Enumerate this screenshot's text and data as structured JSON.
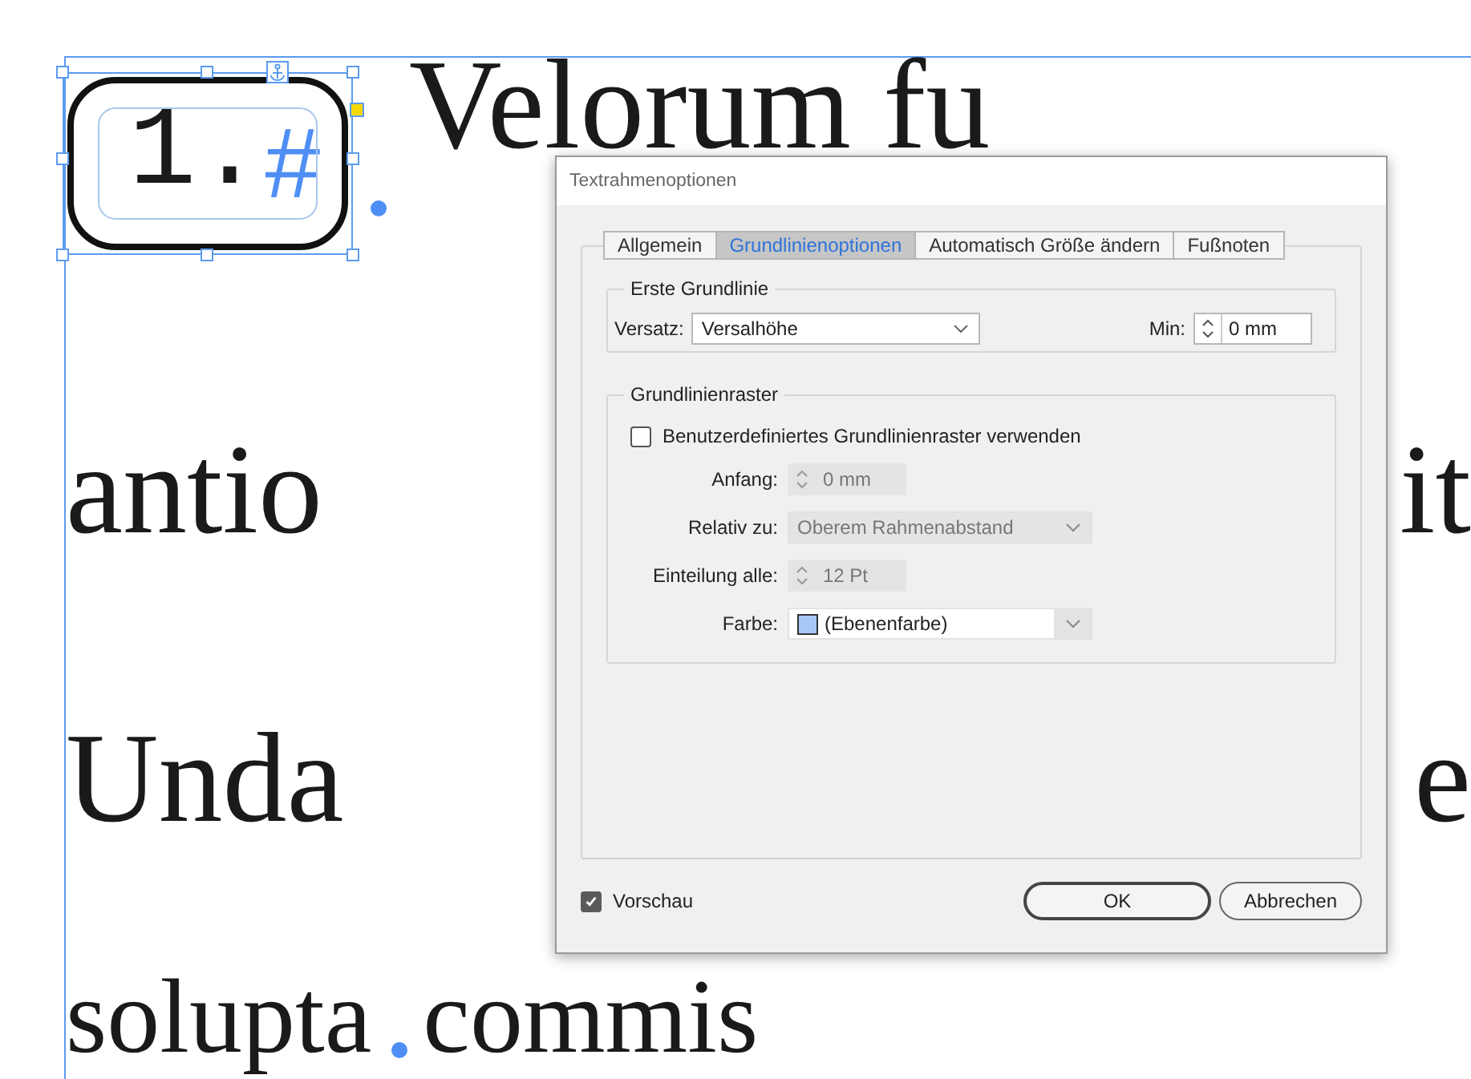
{
  "document": {
    "anchored_frame": {
      "number": "1.",
      "marker": "#"
    },
    "lines": [
      {
        "kind": "anchored",
        "segments": [
          "Velorum fu"
        ]
      },
      {
        "kind": "split",
        "segments": [
          "antio",
          "it"
        ]
      },
      {
        "kind": "split",
        "segments": [
          "Unda",
          "e"
        ]
      },
      {
        "kind": "dotted",
        "segments": [
          "solupta",
          "commis"
        ]
      }
    ]
  },
  "dialog": {
    "title": "Textrahmenoptionen",
    "tabs": [
      {
        "label": "Allgemein",
        "selected": false
      },
      {
        "label": "Grundlinienoptionen",
        "selected": true
      },
      {
        "label": "Automatisch Größe ändern",
        "selected": false
      },
      {
        "label": "Fußnoten",
        "selected": false
      }
    ],
    "first_baseline": {
      "legend": "Erste Grundlinie",
      "offset": {
        "label": "Versatz:",
        "value": "Versalhöhe"
      },
      "min": {
        "label": "Min:",
        "value": "0 mm"
      }
    },
    "baseline_grid": {
      "legend": "Grundlinienraster",
      "custom": {
        "label": "Benutzerdefiniertes Grundlinienraster verwenden",
        "checked": false
      },
      "fields": [
        {
          "kind": "spinner",
          "label": "Anfang:",
          "value": "0 mm",
          "disabled": true
        },
        {
          "kind": "dropdown",
          "label": "Relativ zu:",
          "value": "Oberem Rahmenabstand",
          "disabled": true
        },
        {
          "kind": "spinner",
          "label": "Einteilung alle:",
          "value": "12 Pt",
          "disabled": true
        },
        {
          "kind": "color_dropdown",
          "label": "Farbe:",
          "value": "(Ebenenfarbe)",
          "disabled": false,
          "color": "#a8c8f8"
        }
      ]
    },
    "preview": {
      "label": "Vorschau",
      "checked": true
    },
    "buttons": [
      {
        "label": "OK",
        "default": true
      },
      {
        "label": "Abbrechen",
        "default": false
      }
    ]
  }
}
